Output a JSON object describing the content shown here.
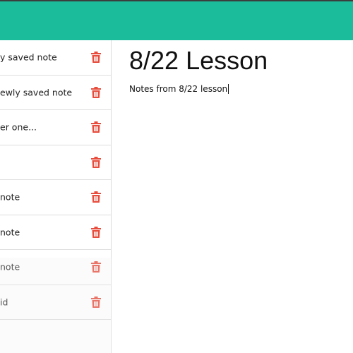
{
  "colors": {
    "header": "#1bbc9b",
    "trash": "#e74c3c"
  },
  "sidebar": {
    "items": [
      {
        "label": "y saved note",
        "icon": "trash-icon"
      },
      {
        "label": "ewly saved note",
        "icon": "trash-icon"
      },
      {
        "label": "er one...",
        "icon": "trash-icon"
      },
      {
        "label": "",
        "icon": "trash-icon"
      },
      {
        "label": "note",
        "icon": "trash-icon"
      },
      {
        "label": "note",
        "icon": "trash-icon"
      },
      {
        "label": "note",
        "icon": "trash-icon"
      },
      {
        "label": "id",
        "icon": "trash-icon"
      }
    ]
  },
  "note": {
    "title": "8/22 Lesson",
    "body": "Notes from 8/22 lesson"
  }
}
